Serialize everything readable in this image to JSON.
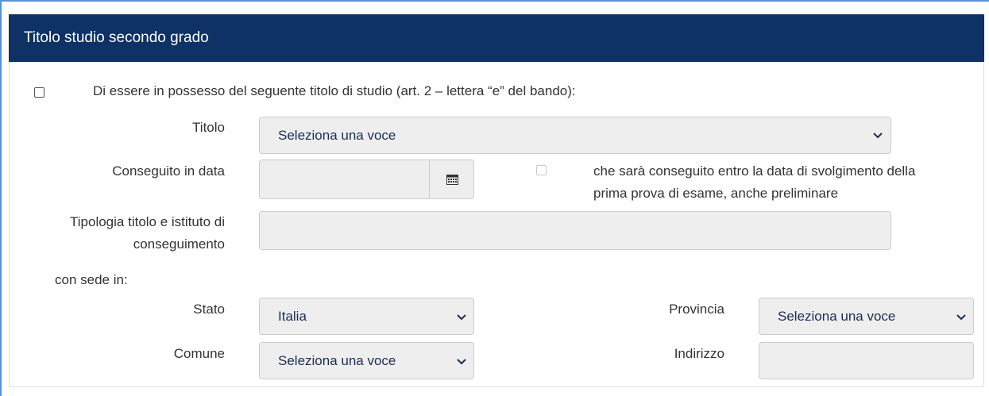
{
  "panel": {
    "title": "Titolo studio secondo grado"
  },
  "declaration": {
    "label": "Di essere in possesso del seguente titolo di studio (art. 2 – lettera “e” del bando):"
  },
  "titolo": {
    "label": "Titolo",
    "value": "Seleziona una voce"
  },
  "conseguito": {
    "label": "Conseguito in data",
    "value": "",
    "future_label_line1": "che sarà conseguito entro la data di svolgimento della",
    "future_label_line2": "prima prova di esame, anche preliminare"
  },
  "tipologia": {
    "label_line1": "Tipologia titolo e istituto di",
    "label_line2": "conseguimento",
    "value": ""
  },
  "sede": {
    "heading": "con sede in:",
    "stato_label": "Stato",
    "stato_value": "Italia",
    "provincia_label": "Provincia",
    "provincia_value": "Seleziona una voce",
    "comune_label": "Comune",
    "comune_value": "Seleziona una voce",
    "indirizzo_label": "Indirizzo",
    "indirizzo_value": ""
  },
  "icons": {
    "calendar": "calendar-icon",
    "chevron": "chevron-down-icon"
  },
  "colors": {
    "header_bg": "#0e3265",
    "field_bg": "#eeeeee",
    "select_text": "#1a2e55"
  }
}
